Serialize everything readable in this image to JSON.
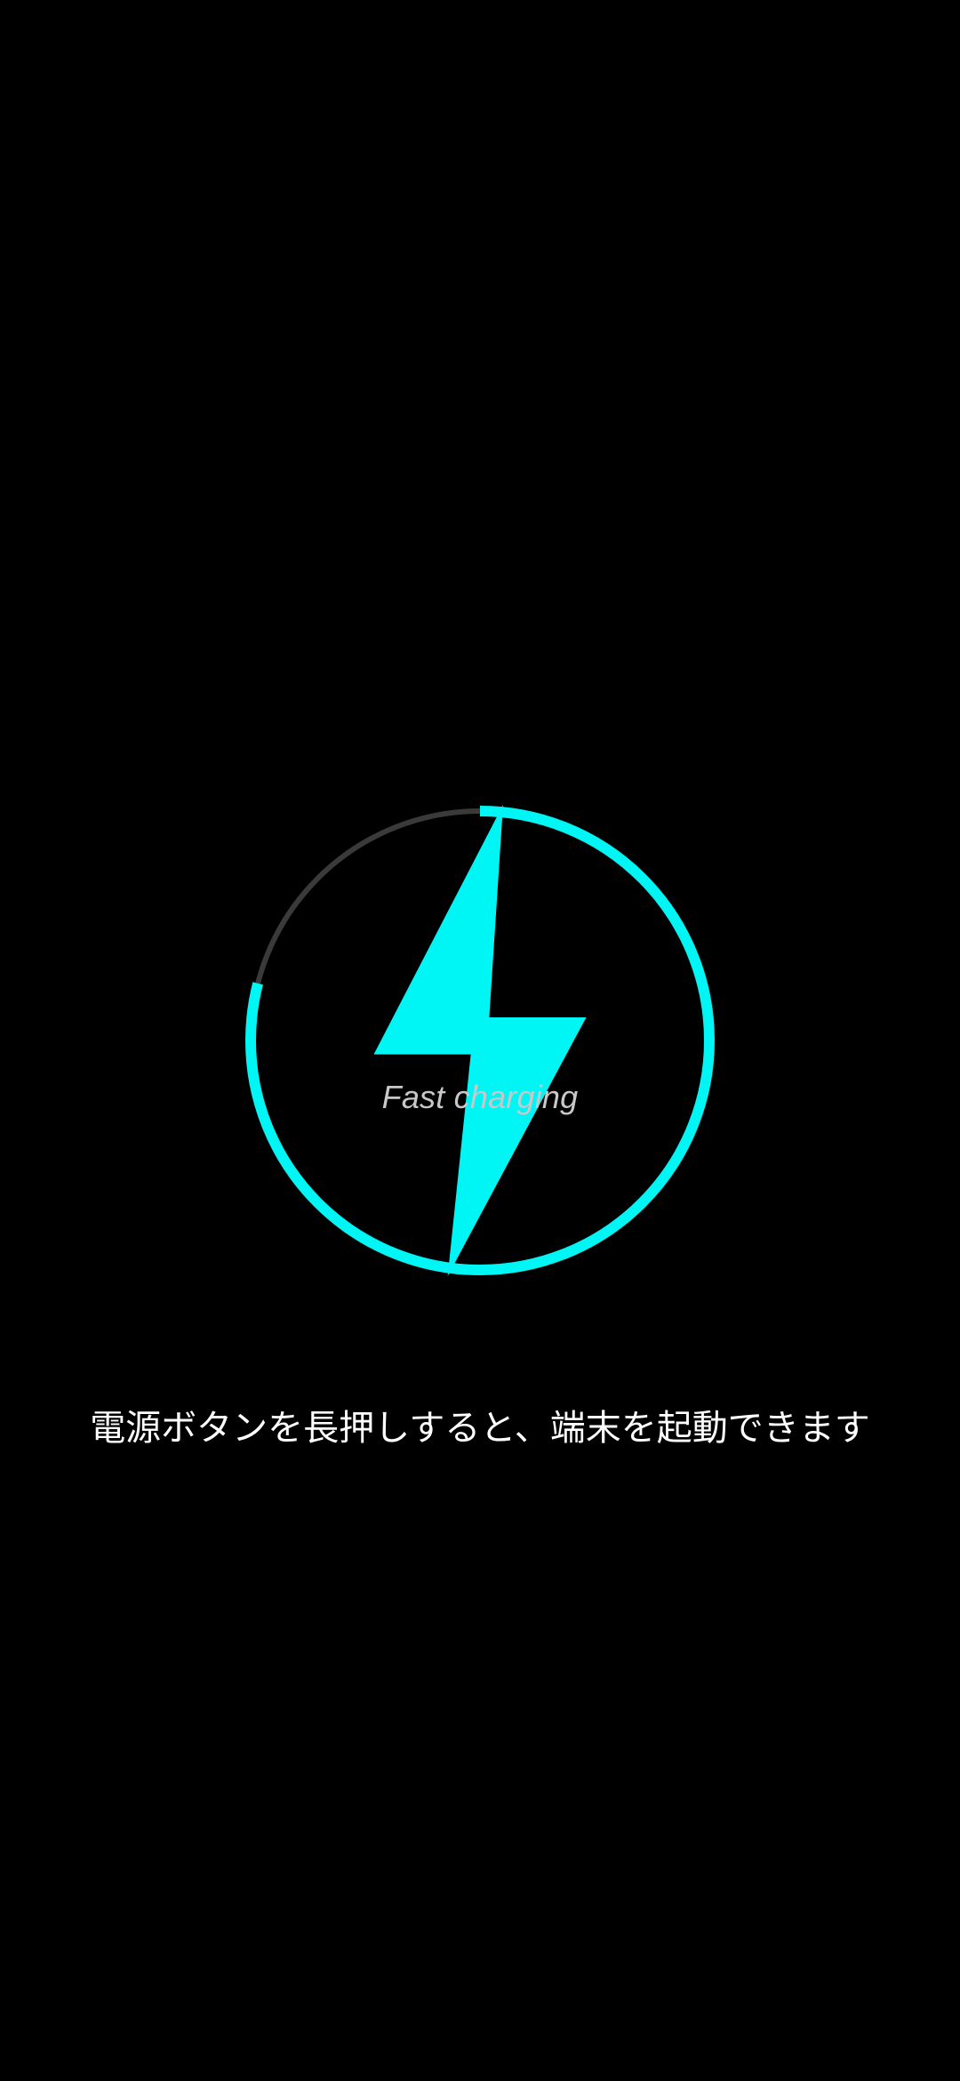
{
  "charging": {
    "status_label": "Fast charging",
    "level_fraction": 0.79,
    "progress_color": "#00f5f5",
    "track_color": "#3a3a3a",
    "icon": "lightning-bolt-icon"
  },
  "hint": {
    "text": "電源ボタンを長押しすると、端末を起動できます"
  }
}
